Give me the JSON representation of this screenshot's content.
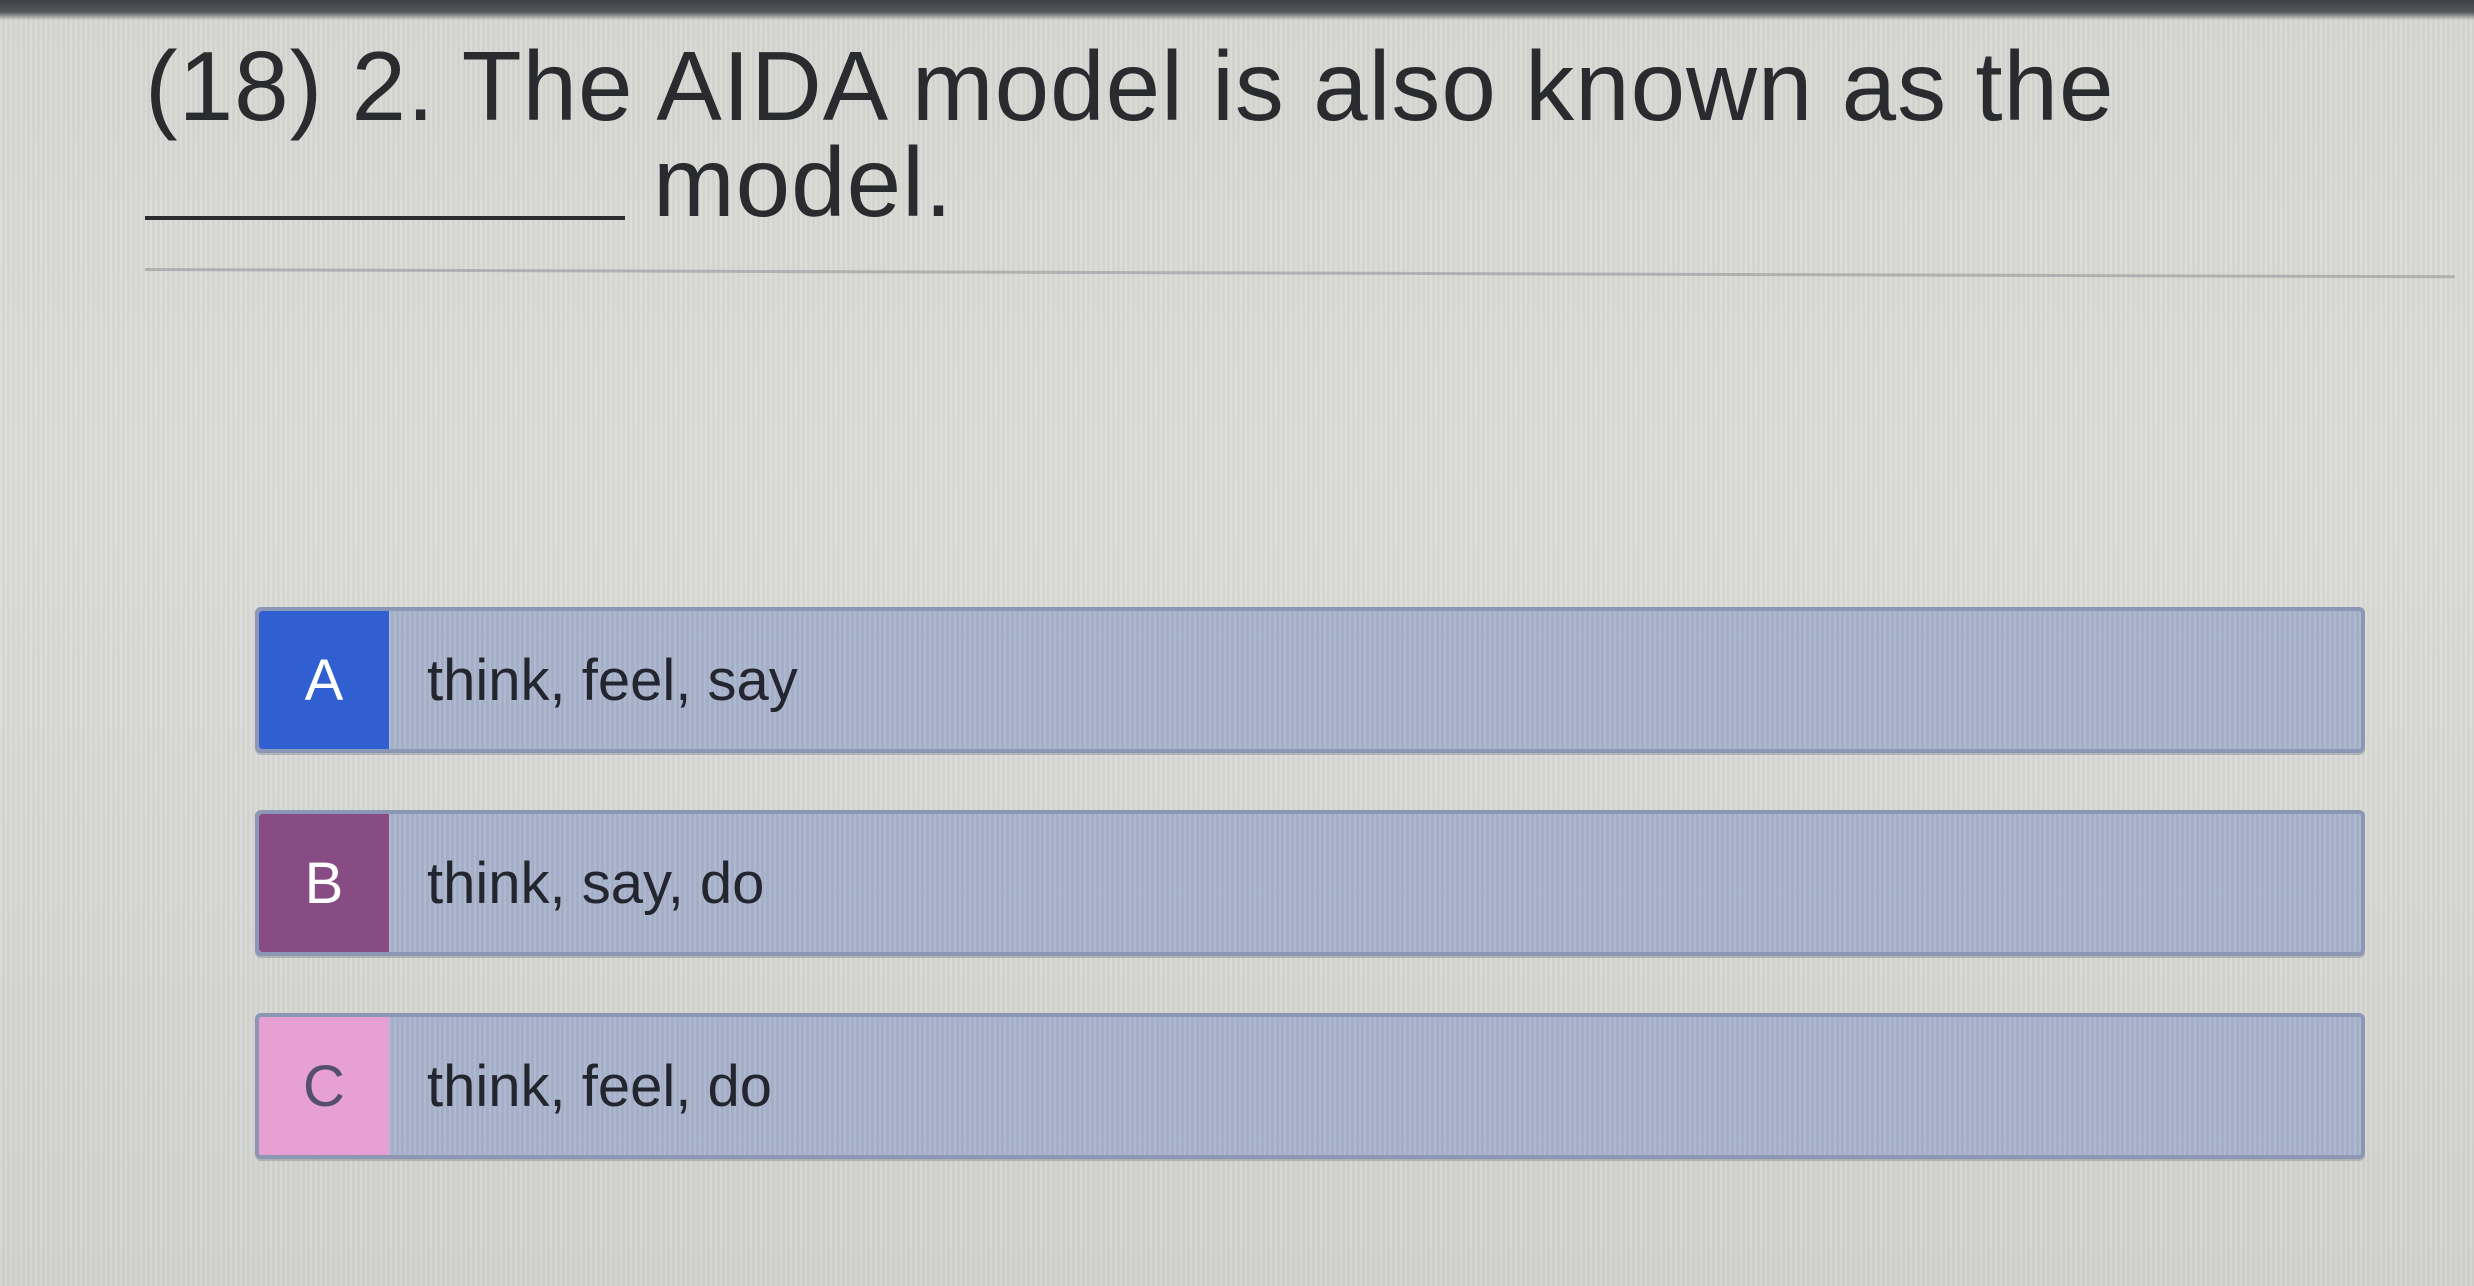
{
  "question": {
    "line1": "(18) 2. The AIDA model is also known as the",
    "line2": "model."
  },
  "options": [
    {
      "letter": "A",
      "text": "think, feel, say",
      "color": "#2f5fd1"
    },
    {
      "letter": "B",
      "text": "think, say, do",
      "color": "#874c84"
    },
    {
      "letter": "C",
      "text": "think, feel, do",
      "color": "#e6a1d2"
    }
  ]
}
